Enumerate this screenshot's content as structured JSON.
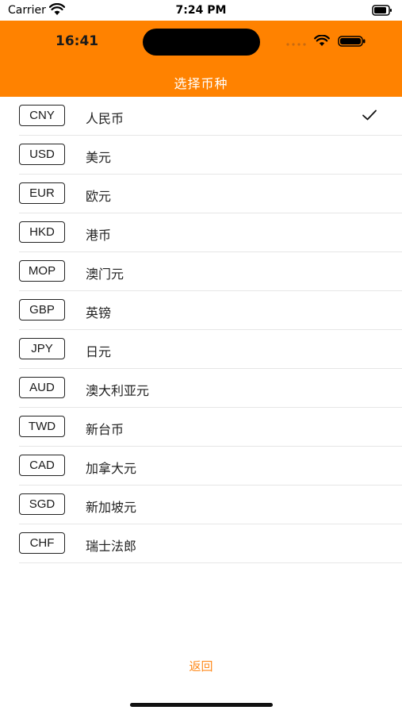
{
  "simulator_status": {
    "carrier": "Carrier",
    "time": "7:24 PM"
  },
  "device_status": {
    "time": "16:41"
  },
  "header": {
    "title": "选择币种"
  },
  "currencies": [
    {
      "code": "CNY",
      "name": "人民币",
      "selected": true
    },
    {
      "code": "USD",
      "name": "美元",
      "selected": false
    },
    {
      "code": "EUR",
      "name": "欧元",
      "selected": false
    },
    {
      "code": "HKD",
      "name": "港币",
      "selected": false
    },
    {
      "code": "MOP",
      "name": "澳门元",
      "selected": false
    },
    {
      "code": "GBP",
      "name": "英镑",
      "selected": false
    },
    {
      "code": "JPY",
      "name": "日元",
      "selected": false
    },
    {
      "code": "AUD",
      "name": "澳大利亚元",
      "selected": false
    },
    {
      "code": "TWD",
      "name": "新台币",
      "selected": false
    },
    {
      "code": "CAD",
      "name": "加拿大元",
      "selected": false
    },
    {
      "code": "SGD",
      "name": "新加坡元",
      "selected": false
    },
    {
      "code": "CHF",
      "name": "瑞士法郎",
      "selected": false
    }
  ],
  "footer": {
    "back_label": "返回"
  },
  "icons": {
    "selected": "checkmark-icon",
    "wifi": "wifi-icon",
    "battery": "battery-icon",
    "signal": "signal-icon"
  },
  "colors": {
    "header_bg": "#ff8200",
    "back_link": "#ff8a1c"
  }
}
